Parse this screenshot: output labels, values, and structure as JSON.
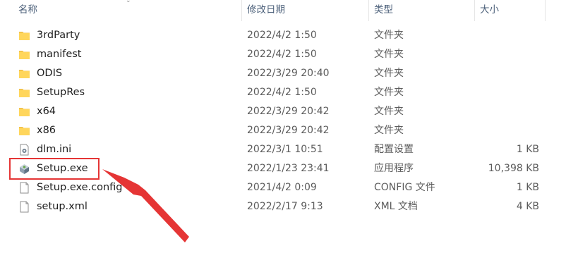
{
  "columns": {
    "name": "名称",
    "modified": "修改日期",
    "type": "类型",
    "size": "大小"
  },
  "files": [
    {
      "name": "3rdParty",
      "modified": "2022/4/2 1:50",
      "type": "文件夹",
      "size": "",
      "icon": "folder-icon"
    },
    {
      "name": "manifest",
      "modified": "2022/4/2 1:50",
      "type": "文件夹",
      "size": "",
      "icon": "folder-icon"
    },
    {
      "name": "ODIS",
      "modified": "2022/3/29 20:40",
      "type": "文件夹",
      "size": "",
      "icon": "folder-icon"
    },
    {
      "name": "SetupRes",
      "modified": "2022/4/2 1:50",
      "type": "文件夹",
      "size": "",
      "icon": "folder-icon"
    },
    {
      "name": "x64",
      "modified": "2022/3/29 20:42",
      "type": "文件夹",
      "size": "",
      "icon": "folder-icon"
    },
    {
      "name": "x86",
      "modified": "2022/3/29 20:42",
      "type": "文件夹",
      "size": "",
      "icon": "folder-icon"
    },
    {
      "name": "dlm.ini",
      "modified": "2022/3/1 10:51",
      "type": "配置设置",
      "size": "1 KB",
      "icon": "ini-file-icon"
    },
    {
      "name": "Setup.exe",
      "modified": "2022/1/23 23:41",
      "type": "应用程序",
      "size": "10,398 KB",
      "icon": "installer-icon"
    },
    {
      "name": "Setup.exe.config",
      "modified": "2021/4/2 0:09",
      "type": "CONFIG 文件",
      "size": "1 KB",
      "icon": "file-icon"
    },
    {
      "name": "setup.xml",
      "modified": "2022/2/17 9:13",
      "type": "XML 文档",
      "size": "4 KB",
      "icon": "file-icon"
    }
  ],
  "colors": {
    "highlight": "#e53535",
    "folder": "#f3c34a",
    "header_text": "#4c607a"
  }
}
